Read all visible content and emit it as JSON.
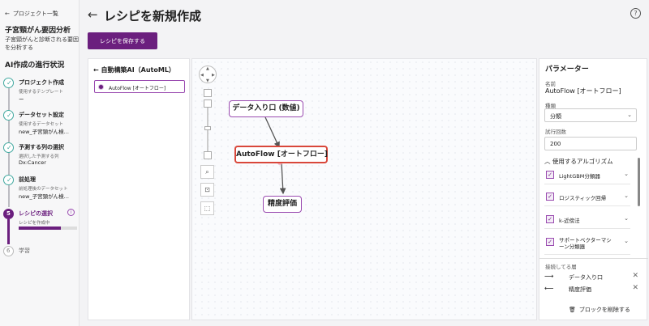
{
  "sidebar": {
    "back_label": "プロジェクト一覧",
    "project_title": "子宮頸がん要因分析",
    "project_desc": "子宮頸がんと診断される要因を分析する",
    "status_title": "AI作成の進行状況",
    "steps": [
      {
        "title": "プロジェクト作成",
        "sub": "使用するテンプレート",
        "value": "ー"
      },
      {
        "title": "データセット設定",
        "sub": "使用するデータセット",
        "value": "new_子宮頸がん検..."
      },
      {
        "title": "予測する列の選択",
        "sub": "選択した予測する列",
        "value": "Dx:Cancer"
      },
      {
        "title": "前処理",
        "sub": "前処理後のデータセット",
        "value": "new_子宮頸がん検..."
      },
      {
        "number": "5",
        "title": "レシピの選択",
        "sub": "レシピを作成中",
        "progress": 0.72
      },
      {
        "number": "6",
        "title": "学習"
      }
    ]
  },
  "header": {
    "title": "レシピを新規作成",
    "save_label": "レシピを保存する"
  },
  "algo_panel": {
    "heading": "自動構築AI（AutoML）",
    "item_label": "AutoFlow [オートフロー]"
  },
  "canvas": {
    "nodes": {
      "data_input": "データ入り口 (数値)",
      "autoflow": "AutoFlow [オートフロー]",
      "accuracy": "精度評価"
    }
  },
  "params": {
    "title": "パラメーター",
    "name_label": "名前",
    "name_value": "AutoFlow [オートフロー]",
    "type_label": "種類",
    "type_value": "分類",
    "trials_label": "試行回数",
    "trials_value": "200",
    "algo_section": "使用するアルゴリズム",
    "algorithms": [
      "LightGBM分類器",
      "ロジスティック回帰",
      "k-近傍法",
      "サポートベクターマシーン分類器"
    ],
    "connected_label": "接続してる層",
    "connections": [
      "データ入り口",
      "精度評価"
    ],
    "delete_label": "ブロックを削除する"
  }
}
